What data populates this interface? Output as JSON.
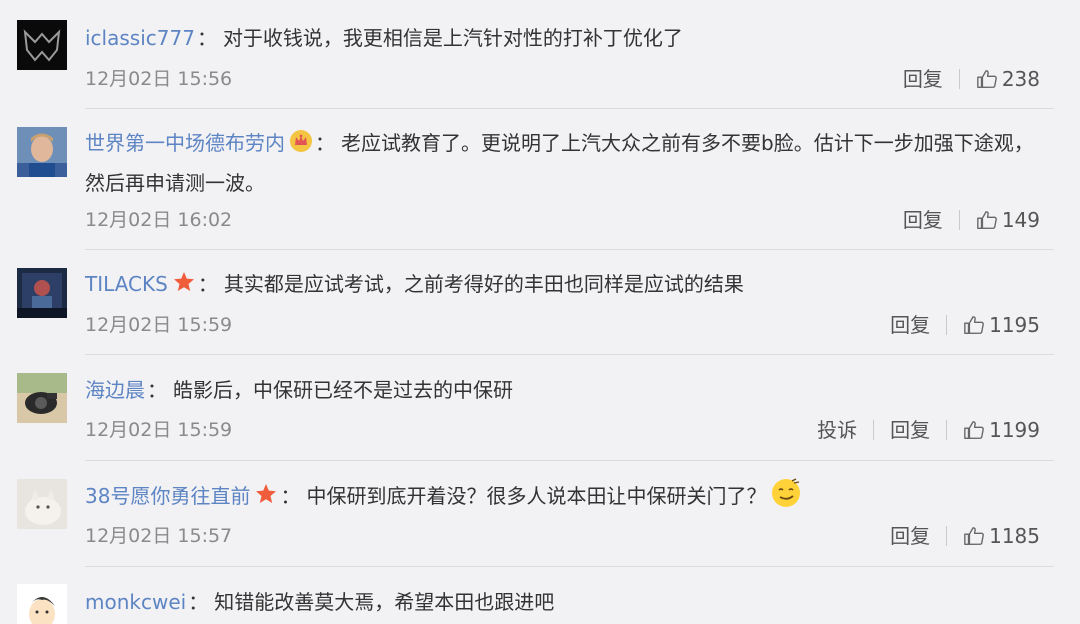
{
  "colon": "：",
  "comments": [
    {
      "username": "iclassic777",
      "text": "对于收钱说，我更相信是上汽针对性的打补丁优化了",
      "time": "12月02日 15:56",
      "reply": "回复",
      "likes": "238"
    },
    {
      "username": "世界第一中场德布劳内",
      "badge_icon": "crown-icon",
      "text": "老应试教育了。更说明了上汽大众之前有多不要b脸。估计下一步加强下途观，然后再申请测一波。",
      "time": "12月02日 16:02",
      "reply": "回复",
      "likes": "149"
    },
    {
      "username": "TILACKS",
      "badge_icon": "star-icon",
      "text": "其实都是应试考试，之前考得好的丰田也同样是应试的结果",
      "time": "12月02日 15:59",
      "reply": "回复",
      "likes": "1195"
    },
    {
      "username": "海边晨",
      "text": "皓影后，中保研已经不是过去的中保研",
      "time": "12月02日 15:59",
      "report": "投诉",
      "reply": "回复",
      "likes": "1199"
    },
    {
      "username": "38号愿你勇往直前",
      "badge_icon": "star-icon",
      "text": "中保研到底开着没？很多人说本田让中保研关门了？",
      "emoji_icon": "smirk-emoji-icon",
      "time": "12月02日 15:57",
      "reply": "回复",
      "likes": "1185"
    },
    {
      "username": "monkcwei",
      "text": "知错能改善莫大焉，希望本田也跟进吧"
    }
  ]
}
